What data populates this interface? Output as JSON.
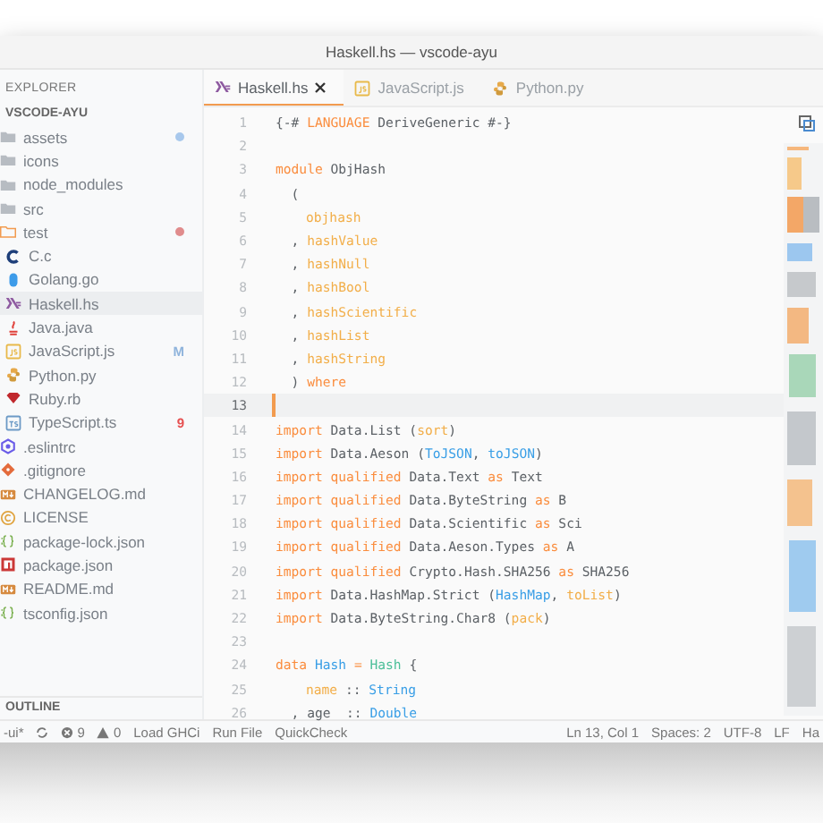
{
  "window": {
    "title": "Haskell.hs — vscode-ayu"
  },
  "sidebar": {
    "title": "EXPLORER",
    "folder": "VSCODE-AYU",
    "outline": "OUTLINE",
    "items": [
      {
        "label": "assets",
        "kind": "folder",
        "selected": false,
        "color": "#a8c8ec"
      },
      {
        "label": "icons",
        "kind": "folder",
        "selected": false
      },
      {
        "label": "node_modules",
        "kind": "folder",
        "selected": false
      },
      {
        "label": "src",
        "kind": "folder",
        "selected": false
      },
      {
        "label": "test",
        "kind": "folder-open",
        "selected": false,
        "color": "#e08c8c"
      },
      {
        "label": "C.c",
        "kind": "c",
        "selected": false,
        "nested": true
      },
      {
        "label": "Golang.go",
        "kind": "go",
        "selected": false,
        "nested": true
      },
      {
        "label": "Haskell.hs",
        "kind": "haskell",
        "selected": true,
        "nested": true
      },
      {
        "label": "Java.java",
        "kind": "java",
        "selected": false,
        "nested": true
      },
      {
        "label": "JavaScript.js",
        "kind": "js",
        "selected": false,
        "nested": true,
        "badge": {
          "text": "M",
          "kind": "modified"
        }
      },
      {
        "label": "Python.py",
        "kind": "python",
        "selected": false,
        "nested": true
      },
      {
        "label": "Ruby.rb",
        "kind": "ruby",
        "selected": false,
        "nested": true
      },
      {
        "label": "TypeScript.ts",
        "kind": "ts",
        "selected": false,
        "nested": true,
        "badge": {
          "text": "9",
          "kind": "problems"
        }
      },
      {
        "label": ".eslintrc",
        "kind": "eslint",
        "selected": false
      },
      {
        "label": ".gitignore",
        "kind": "git",
        "selected": false
      },
      {
        "label": "CHANGELOG.md",
        "kind": "markdown",
        "selected": false
      },
      {
        "label": "LICENSE",
        "kind": "license",
        "selected": false
      },
      {
        "label": "package-lock.json",
        "kind": "json",
        "selected": false
      },
      {
        "label": "package.json",
        "kind": "npm",
        "selected": false
      },
      {
        "label": "README.md",
        "kind": "markdown",
        "selected": false
      },
      {
        "label": "tsconfig.json",
        "kind": "json",
        "selected": false
      }
    ]
  },
  "tabs": [
    {
      "label": "Haskell.hs",
      "kind": "haskell",
      "selected": true
    },
    {
      "label": "JavaScript.js",
      "kind": "js",
      "selected": false
    },
    {
      "label": "Python.py",
      "kind": "python",
      "selected": false
    }
  ],
  "editor": {
    "lines": [
      {
        "number": "1",
        "current": false,
        "tokens": [
          {
            "kind": "plain",
            "text": "{-# "
          },
          {
            "kind": "keyword",
            "text": "LANGUAGE"
          },
          {
            "kind": "plain",
            "text": " DeriveGeneric #-}"
          }
        ]
      },
      {
        "number": "2",
        "current": false
      },
      {
        "number": "3",
        "current": false,
        "tokens": [
          {
            "kind": "keyword",
            "text": "module"
          },
          {
            "kind": "plain",
            "text": " ObjHash"
          }
        ]
      },
      {
        "number": "4",
        "current": false,
        "tokens": [
          {
            "kind": "plain",
            "text": "  ("
          }
        ]
      },
      {
        "number": "5",
        "current": false,
        "indented": true,
        "tokens": [
          {
            "kind": "function",
            "text": "objhash"
          }
        ]
      },
      {
        "number": "6",
        "current": false,
        "tokens": [
          {
            "kind": "plain",
            "text": "  , "
          },
          {
            "kind": "function",
            "text": "hashValue"
          }
        ]
      },
      {
        "number": "7",
        "current": false,
        "tokens": [
          {
            "kind": "plain",
            "text": "  , "
          },
          {
            "kind": "function",
            "text": "hashNull"
          }
        ]
      },
      {
        "number": "8",
        "current": false,
        "tokens": [
          {
            "kind": "plain",
            "text": "  , "
          },
          {
            "kind": "function",
            "text": "hashBool"
          }
        ]
      },
      {
        "number": "9",
        "current": false,
        "tokens": [
          {
            "kind": "plain",
            "text": "  , "
          },
          {
            "kind": "function",
            "text": "hashScientific"
          }
        ]
      },
      {
        "number": "10",
        "current": false,
        "tokens": [
          {
            "kind": "plain",
            "text": "  , "
          },
          {
            "kind": "function",
            "text": "hashList"
          }
        ]
      },
      {
        "number": "11",
        "current": false,
        "tokens": [
          {
            "kind": "plain",
            "text": "  , "
          },
          {
            "kind": "function",
            "text": "hashString"
          }
        ]
      },
      {
        "number": "12",
        "current": false,
        "tokens": [
          {
            "kind": "plain",
            "text": "  ) "
          },
          {
            "kind": "keyword",
            "text": "where"
          }
        ]
      },
      {
        "number": "13",
        "current": true
      },
      {
        "number": "14",
        "current": false,
        "tokens": [
          {
            "kind": "keyword",
            "text": "import"
          },
          {
            "kind": "plain",
            "text": " Data.List ("
          },
          {
            "kind": "function",
            "text": "sort"
          },
          {
            "kind": "plain",
            "text": ")"
          }
        ]
      },
      {
        "number": "15",
        "current": false,
        "tokens": [
          {
            "kind": "keyword",
            "text": "import"
          },
          {
            "kind": "plain",
            "text": " Data.Aeson ("
          },
          {
            "kind": "type",
            "text": "ToJSON"
          },
          {
            "kind": "plain",
            "text": ", "
          },
          {
            "kind": "type",
            "text": "toJSON"
          },
          {
            "kind": "plain",
            "text": ")"
          }
        ]
      },
      {
        "number": "16",
        "current": false,
        "tokens": [
          {
            "kind": "keyword",
            "text": "import qualified"
          },
          {
            "kind": "plain",
            "text": " Data.Text "
          },
          {
            "kind": "keyword",
            "text": "as"
          },
          {
            "kind": "plain",
            "text": " Text"
          }
        ]
      },
      {
        "number": "17",
        "current": false,
        "tokens": [
          {
            "kind": "keyword",
            "text": "import qualified"
          },
          {
            "kind": "plain",
            "text": " Data.ByteString "
          },
          {
            "kind": "keyword",
            "text": "as"
          },
          {
            "kind": "plain",
            "text": " B"
          }
        ]
      },
      {
        "number": "18",
        "current": false,
        "tokens": [
          {
            "kind": "keyword",
            "text": "import qualified"
          },
          {
            "kind": "plain",
            "text": " Data.Scientific "
          },
          {
            "kind": "keyword",
            "text": "as"
          },
          {
            "kind": "plain",
            "text": " Sci"
          }
        ]
      },
      {
        "number": "19",
        "current": false,
        "tokens": [
          {
            "kind": "keyword",
            "text": "import qualified"
          },
          {
            "kind": "plain",
            "text": " Data.Aeson.Types "
          },
          {
            "kind": "keyword",
            "text": "as"
          },
          {
            "kind": "plain",
            "text": " A"
          }
        ]
      },
      {
        "number": "20",
        "current": false,
        "tokens": [
          {
            "kind": "keyword",
            "text": "import qualified"
          },
          {
            "kind": "plain",
            "text": " Crypto.Hash.SHA256 "
          },
          {
            "kind": "keyword",
            "text": "as"
          },
          {
            "kind": "plain",
            "text": " SHA256"
          }
        ]
      },
      {
        "number": "21",
        "current": false,
        "tokens": [
          {
            "kind": "keyword",
            "text": "import"
          },
          {
            "kind": "plain",
            "text": " Data.HashMap.Strict ("
          },
          {
            "kind": "type",
            "text": "HashMap"
          },
          {
            "kind": "plain",
            "text": ", "
          },
          {
            "kind": "function",
            "text": "toList"
          },
          {
            "kind": "plain",
            "text": ")"
          }
        ]
      },
      {
        "number": "22",
        "current": false,
        "tokens": [
          {
            "kind": "keyword",
            "text": "import"
          },
          {
            "kind": "plain",
            "text": " Data.ByteString.Char8 ("
          },
          {
            "kind": "function",
            "text": "pack"
          },
          {
            "kind": "plain",
            "text": ")"
          }
        ]
      },
      {
        "number": "23",
        "current": false
      },
      {
        "number": "24",
        "current": false,
        "tokens": [
          {
            "kind": "keyword",
            "text": "data "
          },
          {
            "kind": "type",
            "text": "Hash "
          },
          {
            "kind": "keyword",
            "text": "= "
          },
          {
            "kind": "constructor",
            "text": "Hash"
          },
          {
            "kind": "plain",
            "text": " {"
          }
        ]
      },
      {
        "number": "25",
        "current": false,
        "indented": true,
        "tokens": [
          {
            "kind": "function",
            "text": "name"
          },
          {
            "kind": "plain",
            "text": " :: "
          },
          {
            "kind": "type",
            "text": "String"
          }
        ]
      },
      {
        "number": "26",
        "current": false,
        "tokens": [
          {
            "kind": "plain",
            "text": "  , age  :: "
          },
          {
            "kind": "type",
            "text": "Double"
          }
        ]
      }
    ]
  },
  "status_bar": {
    "left": [
      {
        "kind": "text",
        "text": "-ui*"
      },
      {
        "kind": "sync"
      },
      {
        "kind": "errors",
        "text": "9"
      },
      {
        "kind": "warnings",
        "text": "0"
      },
      {
        "kind": "text",
        "text": "Load GHCi"
      },
      {
        "kind": "text",
        "text": "Run File"
      },
      {
        "kind": "text",
        "text": "QuickCheck"
      }
    ],
    "right": [
      "Ln 13, Col 1",
      "Spaces: 2",
      "UTF-8",
      "LF",
      "Ha"
    ]
  }
}
